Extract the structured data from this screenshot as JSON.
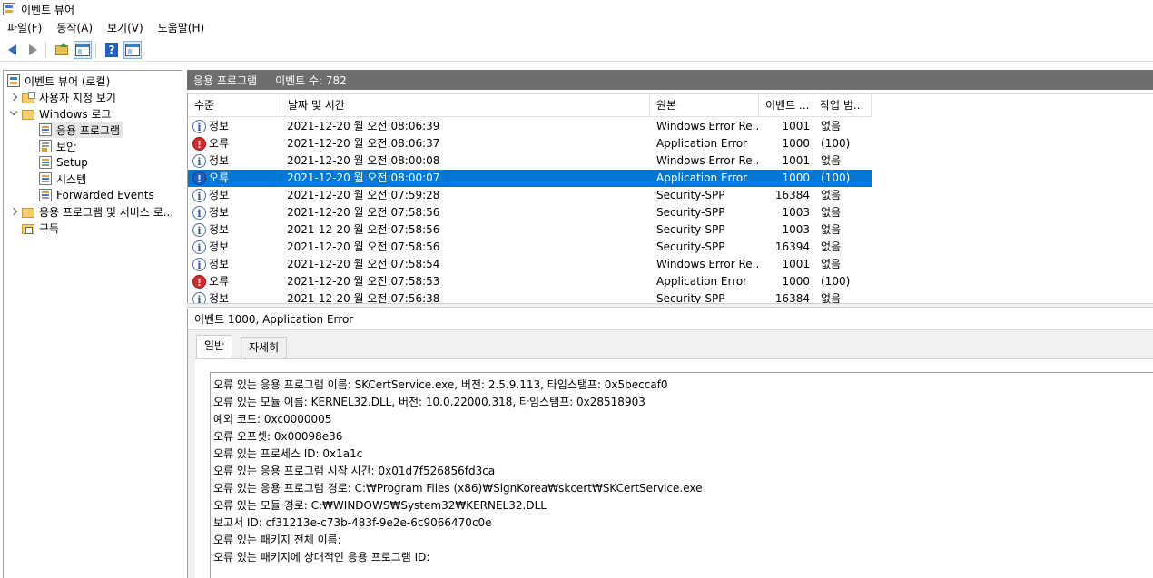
{
  "window": {
    "title": "이벤트 뷰어"
  },
  "menu": [
    "파일(F)",
    "동작(A)",
    "보기(V)",
    "도움말(H)"
  ],
  "toolbar": {
    "icons": [
      "back-icon",
      "forward-icon",
      "folder-up-icon",
      "show-hide-tree-icon",
      "help-icon",
      "show-hide-action-icon"
    ]
  },
  "tree": {
    "root": "이벤트 뷰어 (로컬)",
    "custom_views": "사용자 지정 보기",
    "windows_logs": "Windows 로그",
    "app_log": "응용 프로그램",
    "security": "보안",
    "setup": "Setup",
    "system": "시스템",
    "forwarded": "Forwarded Events",
    "app_service_logs": "응용 프로그램 및 서비스 로...",
    "subscriptions": "구독"
  },
  "list_header": {
    "title": "응용 프로그램",
    "count": "이벤트 수: 782"
  },
  "columns": [
    "수준",
    "날짜 및 시간",
    "원본",
    "이벤트 ...",
    "작업 범..."
  ],
  "events": [
    {
      "level": "정보",
      "type": "info",
      "datetime": "2021-12-20 월 오전:08:06:39",
      "source": "Windows Error Re...",
      "id": "1001",
      "task": "없음"
    },
    {
      "level": "오류",
      "type": "error",
      "datetime": "2021-12-20 월 오전:08:06:37",
      "source": "Application Error",
      "id": "1000",
      "task": "(100)"
    },
    {
      "level": "정보",
      "type": "info",
      "datetime": "2021-12-20 월 오전:08:00:08",
      "source": "Windows Error Re...",
      "id": "1001",
      "task": "없음"
    },
    {
      "level": "오류",
      "type": "error",
      "datetime": "2021-12-20 월 오전:08:00:07",
      "source": "Application Error",
      "id": "1000",
      "task": "(100)",
      "selected": true
    },
    {
      "level": "정보",
      "type": "info",
      "datetime": "2021-12-20 월 오전:07:59:28",
      "source": "Security-SPP",
      "id": "16384",
      "task": "없음"
    },
    {
      "level": "정보",
      "type": "info",
      "datetime": "2021-12-20 월 오전:07:58:56",
      "source": "Security-SPP",
      "id": "1003",
      "task": "없음"
    },
    {
      "level": "정보",
      "type": "info",
      "datetime": "2021-12-20 월 오전:07:58:56",
      "source": "Security-SPP",
      "id": "1003",
      "task": "없음"
    },
    {
      "level": "정보",
      "type": "info",
      "datetime": "2021-12-20 월 오전:07:58:56",
      "source": "Security-SPP",
      "id": "16394",
      "task": "없음"
    },
    {
      "level": "정보",
      "type": "info",
      "datetime": "2021-12-20 월 오전:07:58:54",
      "source": "Windows Error Re...",
      "id": "1001",
      "task": "없음"
    },
    {
      "level": "오류",
      "type": "error",
      "datetime": "2021-12-20 월 오전:07:58:53",
      "source": "Application Error",
      "id": "1000",
      "task": "(100)"
    },
    {
      "level": "정보",
      "type": "info",
      "datetime": "2021-12-20 월 오전:07:56:38",
      "source": "Security-SPP",
      "id": "16384",
      "task": "없음"
    }
  ],
  "detail": {
    "title": "이벤트 1000, Application Error",
    "tabs": [
      "일반",
      "자세히"
    ],
    "lines": [
      "오류 있는 응용 프로그램 이름: SKCertService.exe, 버전: 2.5.9.113, 타임스탬프: 0x5beccaf0",
      "오류 있는 모듈 이름: KERNEL32.DLL, 버전: 10.0.22000.318, 타임스탬프: 0x28518903",
      "예외 코드: 0xc0000005",
      "오류 오프셋: 0x00098e36",
      "오류 있는 프로세스 ID: 0x1a1c",
      "오류 있는 응용 프로그램 시작 시간: 0x01d7f526856fd3ca",
      "오류 있는 응용 프로그램 경로: C:₩Program Files (x86)₩SignKorea₩skcert₩SKCertService.exe",
      "오류 있는 모듈 경로: C:₩WINDOWS₩System32₩KERNEL32.DLL",
      "보고서 ID: cf31213e-c73b-483f-9e2e-6c9066470c0e",
      "오류 있는 패키지 전체 이름:",
      "오류 있는 패키지에 상대적인 응용 프로그램 ID:"
    ]
  },
  "colors": {
    "selection": "#0078d7",
    "header_bar": "#6e6e6e",
    "error": "#d42a2a",
    "info": "#2f5597"
  }
}
